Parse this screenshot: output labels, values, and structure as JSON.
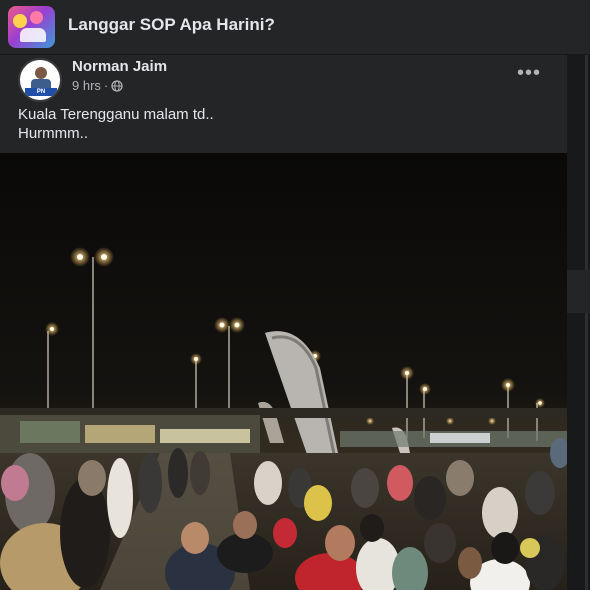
{
  "group": {
    "title": "Langgar SOP Apa Harini?",
    "avatar_icon": "group-avatar-icon"
  },
  "post": {
    "author": "Norman Jaim",
    "author_badge": "PN",
    "time": "9 hrs",
    "separator": "·",
    "privacy_icon": "globe-icon",
    "more_icon": "more-options-icon",
    "more_label": "•••",
    "text_lines": [
      "Kuala Terengganu malam td..",
      "Hurmmm.."
    ],
    "photo_description_icon": "photo-night-market-crowd"
  },
  "colors": {
    "background": "#18191a",
    "card": "#242526",
    "primary_text": "#e4e6eb",
    "secondary_text": "#b0b3b8"
  }
}
